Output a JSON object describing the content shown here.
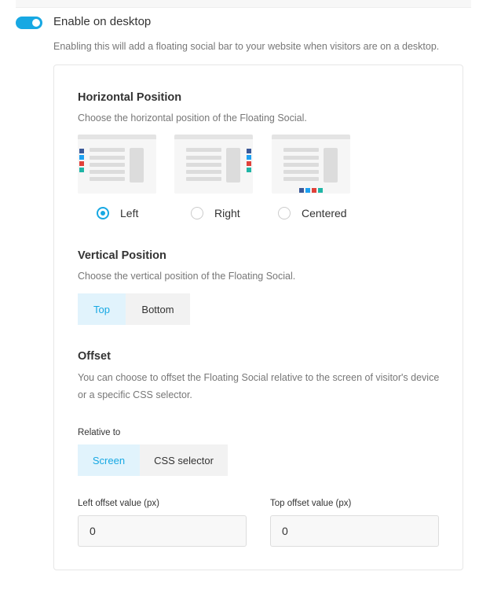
{
  "toggle": {
    "label": "Enable on desktop",
    "enabled": true,
    "description": "Enabling this will add a floating social bar to your website when visitors are on a desktop."
  },
  "horizontal": {
    "title": "Horizontal Position",
    "description": "Choose the horizontal position of the Floating Social.",
    "options": [
      {
        "label": "Left",
        "selected": true
      },
      {
        "label": "Right",
        "selected": false
      },
      {
        "label": "Centered",
        "selected": false
      }
    ]
  },
  "vertical": {
    "title": "Vertical Position",
    "description": "Choose the vertical position of the Floating Social.",
    "options": [
      {
        "label": "Top",
        "selected": true
      },
      {
        "label": "Bottom",
        "selected": false
      }
    ]
  },
  "offset": {
    "title": "Offset",
    "description": "You can choose to offset the Floating Social relative to the screen of visitor's device or a specific CSS selector.",
    "relative_label": "Relative to",
    "relative_options": [
      {
        "label": "Screen",
        "selected": true
      },
      {
        "label": "CSS selector",
        "selected": false
      }
    ],
    "left_label": "Left offset value (px)",
    "left_value": "0",
    "top_label": "Top offset value (px)",
    "top_value": "0"
  },
  "colors": {
    "accent": "#17a8e3",
    "social": [
      "#3b5998",
      "#1da1f2",
      "#e0413a",
      "#1fb5a6"
    ]
  }
}
